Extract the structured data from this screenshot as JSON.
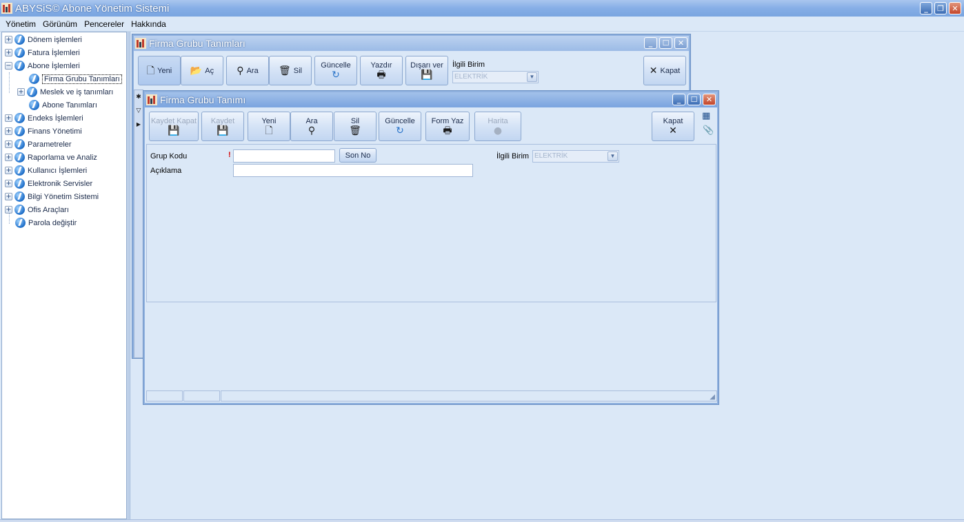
{
  "app": {
    "title": "ABYSiS© Abone Yönetim Sistemi",
    "minimize": "_",
    "restore": "❐",
    "close": "✕"
  },
  "menu": [
    "Yönetim",
    "Görünüm",
    "Pencereler",
    "Hakkında"
  ],
  "tree": [
    {
      "label": "Dönem işlemleri",
      "expander": "+"
    },
    {
      "label": "Fatura İşlemleri",
      "expander": "+"
    },
    {
      "label": "Abone İşlemleri",
      "expander": "−"
    },
    {
      "label": "Firma Grubu Tanımları",
      "child": true,
      "selected": true
    },
    {
      "label": "Meslek ve iş tanımları",
      "child": true,
      "expander": "+"
    },
    {
      "label": "Abone Tanımları",
      "child": true
    },
    {
      "label": "Endeks İşlemleri",
      "expander": "+"
    },
    {
      "label": "Finans Yönetimi",
      "expander": "+"
    },
    {
      "label": "Parametreler",
      "expander": "+"
    },
    {
      "label": "Raporlama ve Analiz",
      "expander": "+"
    },
    {
      "label": "Kullanıcı İşlemleri",
      "expander": "+"
    },
    {
      "label": "Elektronik Servisler",
      "expander": "+"
    },
    {
      "label": "Bilgi Yönetim Sistemi",
      "expander": "+"
    },
    {
      "label": "Ofis Araçları",
      "expander": "+"
    },
    {
      "label": "Parola değiştir"
    }
  ],
  "list_window": {
    "title": "Firma Grubu Tanımları",
    "toolbar": {
      "new": "Yeni",
      "open": "Aç",
      "search": "Ara",
      "delete": "Sil",
      "update": "Güncelle",
      "print": "Yazdır",
      "export": "Dışarı ver",
      "close": "Kapat"
    },
    "unit_label": "İlgili Birim",
    "unit_value": "ELEKTRİK"
  },
  "form_window": {
    "title": "Firma Grubu Tanımı",
    "toolbar": {
      "save_close": "Kaydet Kapat",
      "save": "Kaydet",
      "new": "Yeni",
      "search": "Ara",
      "delete": "Sil",
      "update": "Güncelle",
      "form_print": "Form Yaz",
      "map": "Harita",
      "close": "Kapat"
    },
    "fields": {
      "group_code_label": "Grup Kodu",
      "required_mark": "!",
      "group_code_value": "",
      "last_no_button": "Son No",
      "description_label": "Açıklama",
      "description_value": "",
      "unit_label": "İlgili Birim",
      "unit_value": "ELEKTRİK"
    }
  },
  "colors": {
    "background": "#dbe8f7",
    "titlebar": "#86aee6",
    "close_button": "#c3452a",
    "required": "#d40000"
  }
}
